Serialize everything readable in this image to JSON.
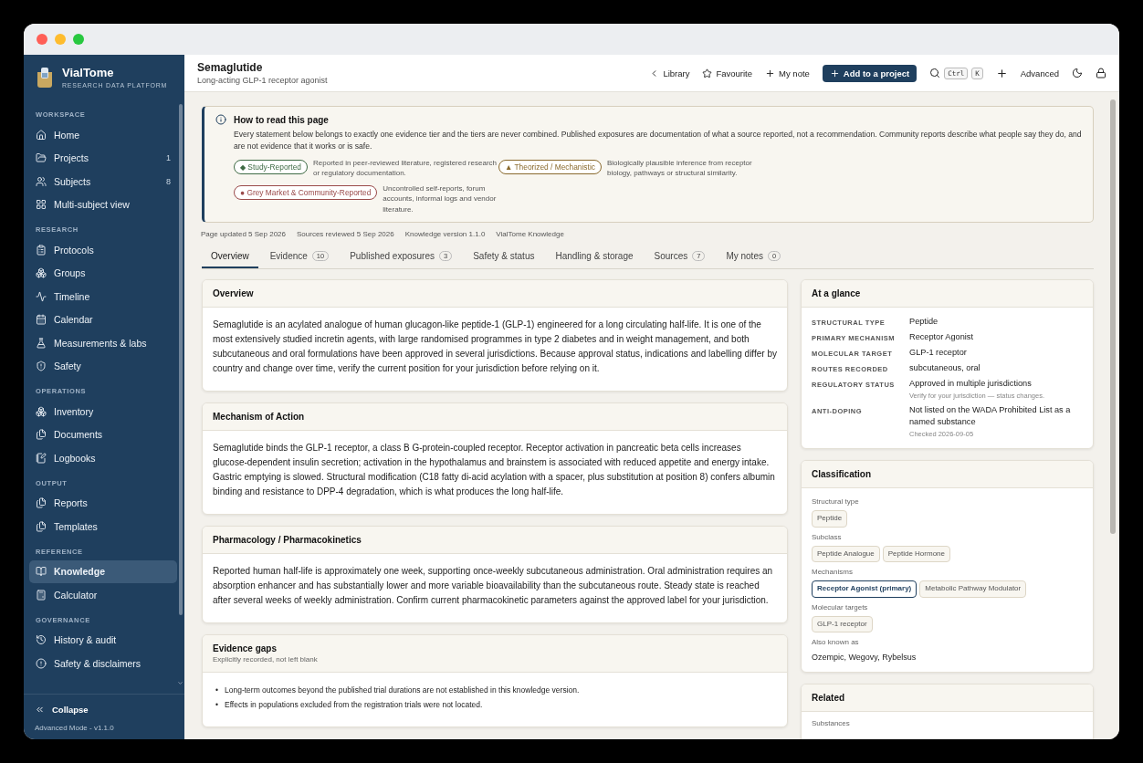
{
  "sidebar": {
    "brand": "VialTome",
    "tagline": "RESEARCH DATA PLATFORM",
    "sections": [
      {
        "title": "WORKSPACE",
        "items": [
          {
            "label": "Home",
            "selected": false
          },
          {
            "label": "Projects",
            "count": "1",
            "selected": false
          },
          {
            "label": "Subjects",
            "count": "8",
            "selected": false
          },
          {
            "label": "Multi-subject view",
            "selected": false
          }
        ]
      },
      {
        "title": "RESEARCH",
        "items": [
          {
            "label": "Protocols",
            "selected": false
          },
          {
            "label": "Groups",
            "selected": false
          },
          {
            "label": "Timeline",
            "selected": false
          },
          {
            "label": "Calendar",
            "selected": false
          },
          {
            "label": "Measurements & labs",
            "selected": false
          },
          {
            "label": "Safety",
            "selected": false
          }
        ]
      },
      {
        "title": "OPERATIONS",
        "items": [
          {
            "label": "Inventory",
            "selected": false
          },
          {
            "label": "Documents",
            "selected": false
          },
          {
            "label": "Logbooks",
            "selected": false
          }
        ]
      },
      {
        "title": "OUTPUT",
        "items": [
          {
            "label": "Reports",
            "selected": false
          },
          {
            "label": "Templates",
            "selected": false
          }
        ]
      },
      {
        "title": "REFERENCE",
        "items": [
          {
            "label": "Knowledge",
            "selected": true
          },
          {
            "label": "Calculator",
            "selected": false
          }
        ]
      },
      {
        "title": "GOVERNANCE",
        "items": [
          {
            "label": "History & audit",
            "selected": false
          },
          {
            "label": "Safety & disclaimers",
            "selected": false
          }
        ]
      }
    ],
    "collapse": "Collapse",
    "footer": "Advanced Mode - v1.1.0"
  },
  "header": {
    "title": "Semaglutide",
    "subtitle": "Long-acting GLP-1 receptor agonist",
    "actions": [
      {
        "label": "Library",
        "kind": "back"
      },
      {
        "label": "Favourite",
        "kind": "star"
      },
      {
        "label": "My note",
        "kind": "plus"
      },
      {
        "label": "Add to a project",
        "kind": "primary"
      }
    ],
    "shortcut_keys": [
      "Ctrl",
      "K"
    ],
    "mode": "Advanced"
  },
  "notice": {
    "title": "How to read this page",
    "text": "Every statement below belongs to exactly one evidence tier and the tiers are never combined. Published exposures are documentation of what a source reported, not a recommendation. Community reports describe what people say they do, and are not evidence that it works or is safe.",
    "tiers": [
      {
        "symbol": "◆",
        "label": "Study-Reported",
        "color": "#3f6b45",
        "description": "Reported in peer-reviewed literature, registered research or regulatory documentation."
      },
      {
        "symbol": "▲",
        "label": "Theorized / Mechanistic",
        "color": "#8a6a2e",
        "description": "Biologically plausible inference from receptor biology, pathways or structural similarity."
      },
      {
        "symbol": "●",
        "label": "Grey Market & Community-Reported",
        "color": "#9a4a4a",
        "description": "Uncontrolled self-reports, forum accounts, informal logs and vendor literature."
      }
    ]
  },
  "meta": [
    "Page updated 5 Sep 2026",
    "Sources reviewed 5 Sep 2026",
    "Knowledge version 1.1.0",
    "VialTome Knowledge"
  ],
  "tabs": [
    {
      "label": "Overview",
      "selected": true
    },
    {
      "label": "Evidence",
      "count": "10",
      "selected": false
    },
    {
      "label": "Published exposures",
      "count": "3",
      "selected": false
    },
    {
      "label": "Safety & status",
      "selected": false
    },
    {
      "label": "Handling & storage",
      "selected": false
    },
    {
      "label": "Sources",
      "count": "7",
      "selected": false
    },
    {
      "label": "My notes",
      "count": "0",
      "selected": false
    }
  ],
  "cards": [
    {
      "title": "Overview",
      "body": "Semaglutide is an acylated analogue of human glucagon-like peptide-1 (GLP-1) engineered for a long circulating half-life. It is one of the most extensively studied incretin agents, with large randomised programmes in type 2 diabetes and in weight management, and both subcutaneous and oral formulations have been approved in several jurisdictions. Because approval status, indications and labelling differ by country and change over time, verify the current position for your jurisdiction before relying on it."
    },
    {
      "title": "Mechanism of Action",
      "body": "Semaglutide binds the GLP-1 receptor, a class B G-protein-coupled receptor. Receptor activation in pancreatic beta cells increases glucose-dependent insulin secretion; activation in the hypothalamus and brainstem is associated with reduced appetite and energy intake. Gastric emptying is slowed. Structural modification (C18 fatty di-acid acylation with a spacer, plus substitution at position 8) confers albumin binding and resistance to DPP-4 degradation, which is what produces the long half-life."
    },
    {
      "title": "Pharmacology / Pharmacokinetics",
      "body": "Reported human half-life is approximately one week, supporting once-weekly subcutaneous administration. Oral administration requires an absorption enhancer and has substantially lower and more variable bioavailability than the subcutaneous route. Steady state is reached after several weeks of weekly administration. Confirm current pharmacokinetic parameters against the approved label for your jurisdiction."
    },
    {
      "title": "Evidence gaps",
      "subtitle": "Explicitly recorded, not left blank",
      "marker": "•",
      "bullets": [
        "Long-term outcomes beyond the published trial durations are not established in this knowledge version.",
        "Effects in populations excluded from the registration trials were not located."
      ]
    }
  ],
  "at_a_glance": {
    "title": "At a glance",
    "rows": [
      {
        "label": "STRUCTURAL TYPE",
        "value": "Peptide"
      },
      {
        "label": "PRIMARY MECHANISM",
        "value": "Receptor Agonist"
      },
      {
        "label": "MOLECULAR TARGET",
        "value": "GLP-1 receptor"
      },
      {
        "label": "ROUTES RECORDED",
        "value": "subcutaneous, oral"
      },
      {
        "label": "REGULATORY STATUS",
        "value": "Approved in multiple jurisdictions",
        "note": "Verify for your jurisdiction — status changes."
      },
      {
        "label": "ANTI-DOPING",
        "value": "Not listed on the WADA Prohibited List as a named substance",
        "note": "Checked 2026-09-05"
      }
    ]
  },
  "classification": {
    "title": "Classification",
    "groups": [
      {
        "label": "Structural type",
        "tags": [
          {
            "label": "Peptide",
            "selected": false
          }
        ]
      },
      {
        "label": "Subclass",
        "tags": [
          {
            "label": "Peptide Analogue",
            "selected": false
          },
          {
            "label": "Peptide Hormone",
            "selected": false
          }
        ]
      },
      {
        "label": "Mechanisms",
        "tags": [
          {
            "label": "Receptor Agonist (primary)",
            "selected": true
          },
          {
            "label": "Metabolic Pathway Modulator",
            "selected": false
          }
        ]
      },
      {
        "label": "Molecular targets",
        "tags": [
          {
            "label": "GLP-1 receptor",
            "selected": false
          }
        ]
      }
    ],
    "aka_label": "Also known as",
    "aka": "Ozempic, Wegovy, Rybelsus"
  },
  "related": {
    "title": "Related",
    "group_label": "Substances"
  }
}
